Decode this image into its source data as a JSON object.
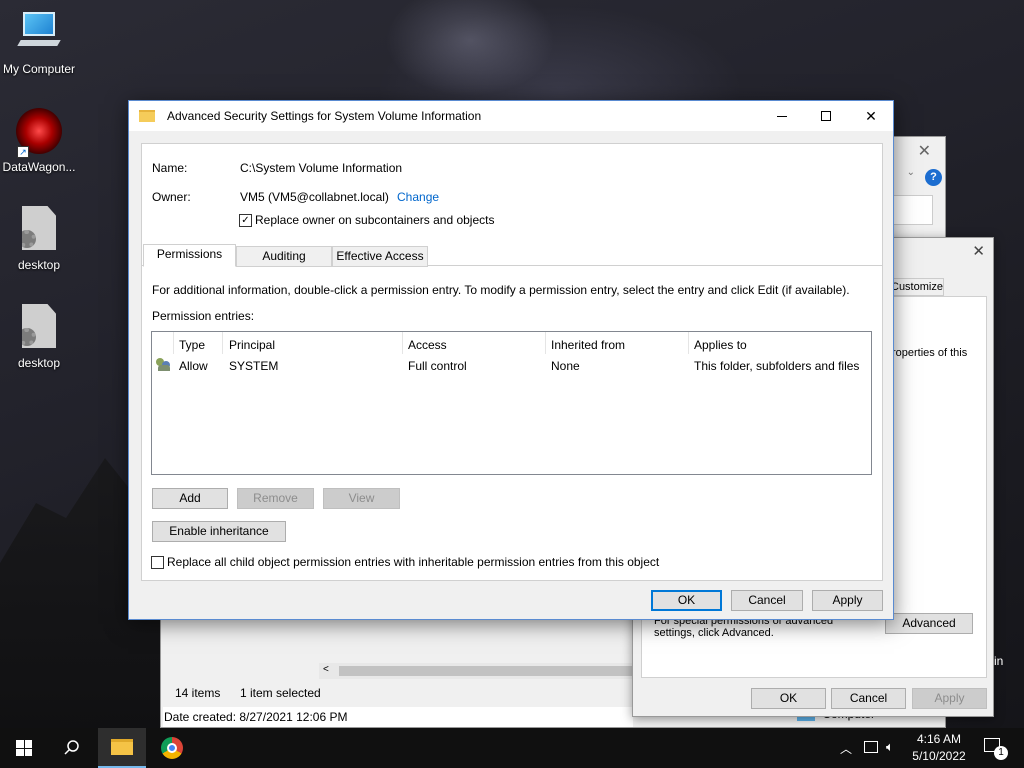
{
  "desktop": {
    "icons": [
      {
        "label": "My Computer"
      },
      {
        "label": "DataWagon..."
      },
      {
        "label": "desktop"
      },
      {
        "label": "desktop"
      }
    ]
  },
  "background_explorer": {
    "customize_tab": "Customize",
    "properties_text": "roperties of this",
    "special_permissions_text": "For special permissions or advanced settings, click Advanced.",
    "advanced_button": "Advanced",
    "ok": "OK",
    "cancel": "Cancel",
    "apply": "Apply",
    "items_count": "14 items",
    "selected_count": "1 item selected",
    "date_created": "Date created: 8/27/2021 12:06 PM",
    "computer_label": "Computer",
    "in_label": "in"
  },
  "dialog": {
    "title": "Advanced Security Settings for System Volume Information",
    "name_label": "Name:",
    "name_value": "C:\\System Volume Information",
    "owner_label": "Owner:",
    "owner_value": "VM5 (VM5@collabnet.local)",
    "change_link": "Change",
    "replace_owner_label": "Replace owner on subcontainers and objects",
    "replace_owner_checked": true,
    "tabs": [
      {
        "label": "Permissions",
        "active": true
      },
      {
        "label": "Auditing",
        "active": false
      },
      {
        "label": "Effective Access",
        "active": false
      }
    ],
    "info_text": "For additional information, double-click a permission entry. To modify a permission entry, select the entry and click Edit (if available).",
    "entries_label": "Permission entries:",
    "columns": [
      "Type",
      "Principal",
      "Access",
      "Inherited from",
      "Applies to"
    ],
    "rows": [
      {
        "type": "Allow",
        "principal": "SYSTEM",
        "access": "Full control",
        "inherited": "None",
        "applies": "This folder, subfolders and files"
      }
    ],
    "add_button": "Add",
    "remove_button": "Remove",
    "view_button": "View",
    "enable_inheritance_button": "Enable inheritance",
    "replace_child_label": "Replace all child object permission entries with inheritable permission entries from this object",
    "replace_child_checked": false,
    "ok_button": "OK",
    "cancel_button": "Cancel",
    "apply_button": "Apply"
  },
  "taskbar": {
    "time": "4:16 AM",
    "date": "5/10/2022",
    "notification_count": "1"
  }
}
